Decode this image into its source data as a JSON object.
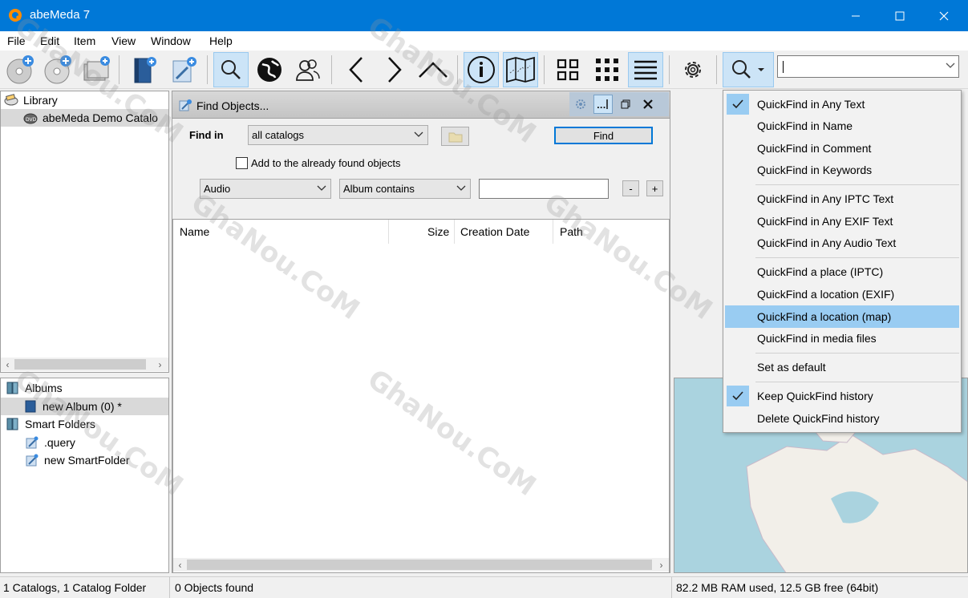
{
  "window": {
    "title": "abeMeda 7",
    "icon": "abemeda-logo-icon",
    "controls": [
      "minimize-icon",
      "maximize-icon",
      "close-icon"
    ]
  },
  "menu": [
    "File",
    "Edit",
    "Item",
    "View",
    "Window",
    "Help"
  ],
  "toolbar": {
    "buttons": [
      "add-disc-icon",
      "add-disc-alt-icon",
      "add-folder-icon",
      "catalog-book-icon",
      "smart-folder-icon",
      "search-icon",
      "globe-icon",
      "people-icon",
      "back-arrow-icon",
      "forward-arrow-icon",
      "up-arrow-icon",
      "info-icon",
      "map-icon",
      "grid-large-icon",
      "grid-small-icon",
      "list-icon",
      "settings-gear-icon",
      "quickfind-search-icon"
    ],
    "quickfind_value": ""
  },
  "library": {
    "header": "Library",
    "items": [
      {
        "label": "abeMeda Demo Catalo"
      }
    ]
  },
  "albums_panel": {
    "albums_header": "Albums",
    "albums": [
      {
        "label": "new Album (0) *"
      }
    ],
    "smart_header": "Smart Folders",
    "smart_folders": [
      {
        "label": ".query"
      },
      {
        "label": "new SmartFolder"
      }
    ]
  },
  "find": {
    "title": "Find Objects...",
    "header_buttons": [
      "gear-icon",
      "rename-icon",
      "restore-icon",
      "close-icon"
    ],
    "find_in_label": "Find in",
    "find_in_value": "all catalogs",
    "find_button": "Find",
    "add_checkbox_label": "Add to the already found objects",
    "add_checkbox_checked": false,
    "criteria_type": "Audio",
    "criteria_op": "Album contains",
    "criteria_value": "",
    "minus_label": "-",
    "plus_label": "+"
  },
  "results": {
    "columns": [
      "Name",
      "Size",
      "Creation Date",
      "Path"
    ],
    "rows": []
  },
  "status": {
    "left": "1 Catalogs, 1 Catalog Folder",
    "middle": "0 Objects found",
    "right": "82.2 MB RAM used, 12.5 GB free (64bit)"
  },
  "quickfind_menu": {
    "items": [
      {
        "label": "QuickFind in Any Text",
        "checked": true
      },
      {
        "label": "QuickFind in Name"
      },
      {
        "label": "QuickFind in Comment"
      },
      {
        "label": "QuickFind in Keywords"
      },
      {
        "label": "QuickFind in Any IPTC Text"
      },
      {
        "label": "QuickFind in Any EXIF Text"
      },
      {
        "label": "QuickFind in Any Audio Text"
      },
      {
        "label": "QuickFind a place (IPTC)"
      },
      {
        "label": "QuickFind a location (EXIF)"
      },
      {
        "label": "QuickFind a location (map)",
        "highlighted": true
      },
      {
        "label": "QuickFind in media files"
      },
      {
        "label": "Set as default"
      },
      {
        "label": "Keep QuickFind history",
        "checked": true
      },
      {
        "label": "Delete QuickFind history"
      }
    ]
  },
  "watermark": "GhaNou.CoM",
  "colors": {
    "titlebar": "#0078d7",
    "selection": "#99ccf2",
    "toolbar_active": "#cce4f7",
    "map_water": "#aad3df",
    "map_land": "#f2efe9"
  }
}
